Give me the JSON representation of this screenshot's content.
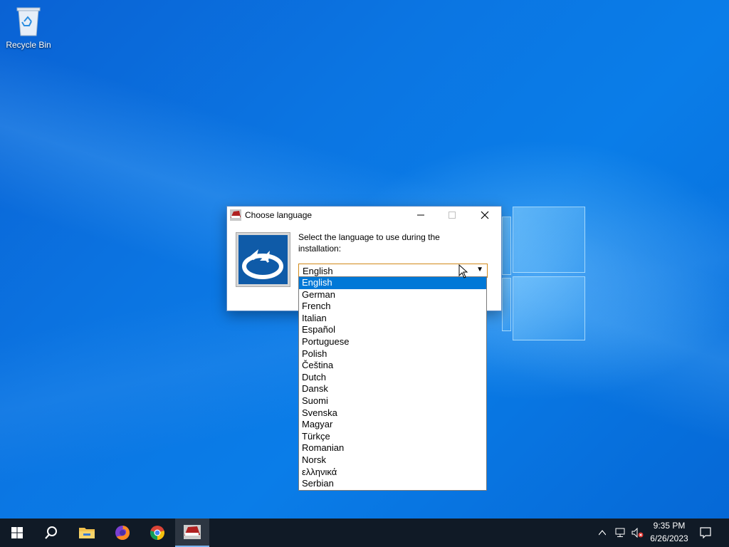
{
  "desktop": {
    "icons": [
      {
        "label": "Recycle Bin",
        "icon": "recycle-bin-icon"
      }
    ]
  },
  "dialog": {
    "title": "Choose language",
    "prompt": "Select the language to use during the installation:",
    "selected_language": "English",
    "buttons": {
      "minimize": "minimize-icon",
      "maximize": "maximize-icon",
      "close": "close-icon"
    }
  },
  "dropdown": {
    "options": [
      "English",
      "German",
      "French",
      "Italian",
      "Español",
      "Portuguese",
      "Polish",
      "Čeština",
      "Dutch",
      "Dansk",
      "Suomi",
      "Svenska",
      "Magyar",
      "Türkçe",
      "Romanian",
      "Norsk",
      "ελληνικά",
      "Serbian"
    ],
    "highlighted_index": 0
  },
  "taskbar": {
    "items": [
      "start-icon",
      "search-icon",
      "file-explorer-icon",
      "firefox-icon",
      "chrome-icon",
      "installer-app-icon"
    ],
    "active_item": "installer-app-icon",
    "tray": {
      "time": "9:35 PM",
      "date": "6/26/2023"
    },
    "colors": {
      "taskbar": "#101a26",
      "accent": "#0078d7"
    }
  }
}
